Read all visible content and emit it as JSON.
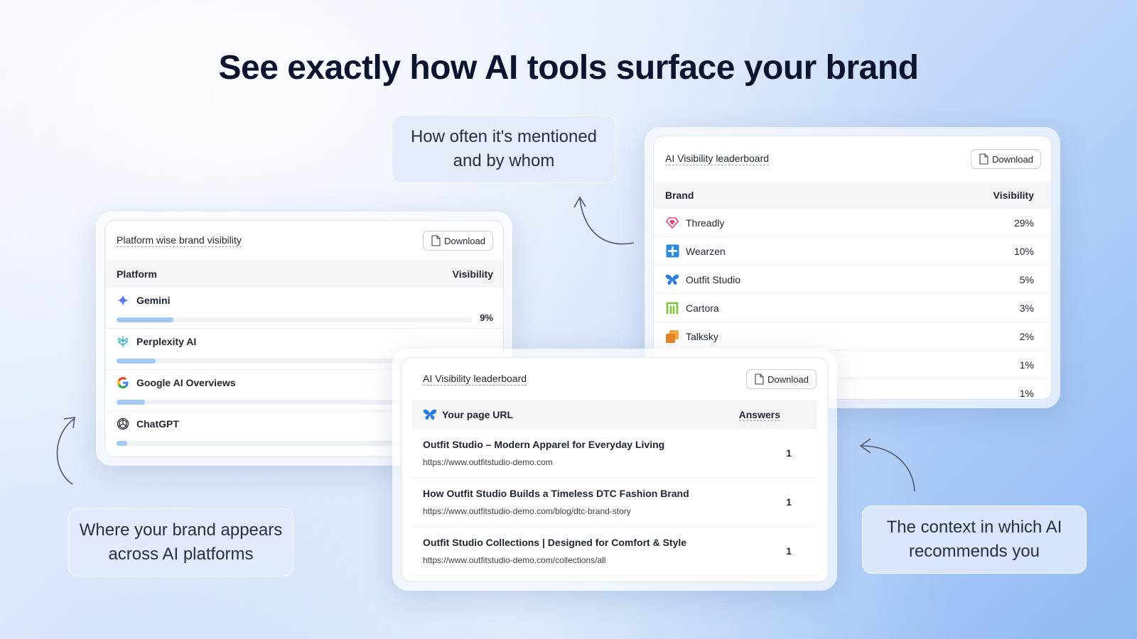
{
  "headline": "See exactly how AI tools surface your brand",
  "callouts": {
    "mentions_line1": "How often it's mentioned",
    "mentions_line2": "and by whom",
    "appears_line1": "Where your brand appears",
    "appears_line2": "across AI platforms",
    "context_line1": "The context in which AI",
    "context_line2": "recommends you"
  },
  "platform_card": {
    "title": "Platform wise brand visibility",
    "download_label": "Download",
    "col_platform": "Platform",
    "col_visibility": "Visibility",
    "rows": [
      {
        "name": "Gemini",
        "icon": "gemini-icon",
        "visibility_pct": 16,
        "label": "9%"
      },
      {
        "name": "Perplexity AI",
        "icon": "perplexity-icon",
        "visibility_pct": 11,
        "label": ""
      },
      {
        "name": "Google AI Overviews",
        "icon": "google-icon",
        "visibility_pct": 8,
        "label": ""
      },
      {
        "name": "ChatGPT",
        "icon": "chatgpt-icon",
        "visibility_pct": 3,
        "label": ""
      }
    ]
  },
  "brand_card": {
    "title": "AI Visibility leaderboard",
    "download_label": "Download",
    "col_brand": "Brand",
    "col_visibility": "Visibility",
    "rows": [
      {
        "name": "Threadly",
        "icon": "heart-gem-icon",
        "value": "29%"
      },
      {
        "name": "Wearzen",
        "icon": "square-cross-icon",
        "value": "10%"
      },
      {
        "name": "Outfit Studio",
        "icon": "butterfly-icon",
        "value": "5%"
      },
      {
        "name": "Cartora",
        "icon": "m-logo-icon",
        "value": "3%"
      },
      {
        "name": "Talksky",
        "icon": "stacked-squares-icon",
        "value": "2%"
      },
      {
        "name": "",
        "icon": "",
        "value": "1%"
      },
      {
        "name": "",
        "icon": "",
        "value": "1%"
      }
    ]
  },
  "url_card": {
    "title": "AI Visibility leaderboard",
    "download_label": "Download",
    "col_url": "Your page URL",
    "col_answers": "Answers",
    "rows": [
      {
        "title": "Outfit Studio – Modern Apparel for Everyday Living",
        "url": "https://www.outfitstudio-demo.com",
        "answers": "1"
      },
      {
        "title": "How Outfit Studio Builds a Timeless DTC Fashion Brand",
        "url": "https://www.outfitstudio-demo.com/blog/dtc-brand-story",
        "answers": "1"
      },
      {
        "title": "Outfit Studio Collections | Designed for Comfort & Style",
        "url": "https://www.outfitstudio-demo.com/collections/all",
        "answers": "1"
      }
    ]
  },
  "colors": {
    "bar_fill": "#a3c8f4",
    "heading": "#0d1430",
    "butterfly_blue": "#2f7de1"
  }
}
